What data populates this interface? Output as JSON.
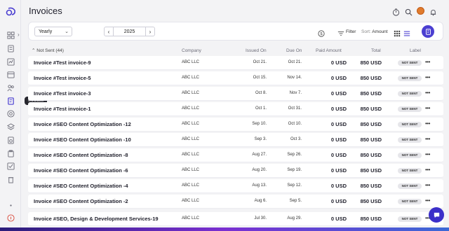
{
  "page": {
    "title": "Invoices",
    "tooltip": "Invoices"
  },
  "toolbar": {
    "period": "Yearly",
    "year": "2025",
    "filter_label": "Filter",
    "sort_label": "Sort:",
    "sort_value": "Amount"
  },
  "table": {
    "group_label": "Not Sent (44)",
    "columns": {
      "company": "Company",
      "issued": "Issued On",
      "due": "Due On",
      "paid": "Paid Amount",
      "total": "Total",
      "label": "Label"
    },
    "rows": [
      {
        "name": "Invoice #Test invoice-9",
        "company": "ABC LLC",
        "issued": "Oct 21.",
        "due": "Oct 21.",
        "paid": "0 USD",
        "total": "850 USD",
        "label": "NOT SENT"
      },
      {
        "name": "Invoice #Test invoice-5",
        "company": "ABC LLC",
        "issued": "Oct 15.",
        "due": "Nov 14.",
        "paid": "0 USD",
        "total": "850 USD",
        "label": "NOT SENT"
      },
      {
        "name": "Invoice #Test invoice-3",
        "company": "ABC LLC",
        "issued": "Oct 8.",
        "due": "Nov 7.",
        "paid": "0 USD",
        "total": "850 USD",
        "label": "NOT SENT"
      },
      {
        "name": "Invoice #Test invoice-1",
        "company": "ABC LLC",
        "issued": "Oct 1.",
        "due": "Oct 31.",
        "paid": "0 USD",
        "total": "850 USD",
        "label": "NOT SENT"
      },
      {
        "name": "Invoice #SEO Content Optimization -12",
        "company": "ABC LLC",
        "issued": "Sep 10.",
        "due": "Oct 10.",
        "paid": "0 USD",
        "total": "850 USD",
        "label": "NOT SENT"
      },
      {
        "name": "Invoice #SEO Content Optimization -10",
        "company": "ABC LLC",
        "issued": "Sep 3.",
        "due": "Oct 3.",
        "paid": "0 USD",
        "total": "850 USD",
        "label": "NOT SENT"
      },
      {
        "name": "Invoice #SEO Content Optimization -8",
        "company": "ABC LLC",
        "issued": "Aug 27.",
        "due": "Sep 26.",
        "paid": "0 USD",
        "total": "850 USD",
        "label": "NOT SENT"
      },
      {
        "name": "Invoice #SEO Content Optimization -6",
        "company": "ABC LLC",
        "issued": "Aug 20.",
        "due": "Sep 19.",
        "paid": "0 USD",
        "total": "850 USD",
        "label": "NOT SENT"
      },
      {
        "name": "Invoice #SEO Content Optimization -4",
        "company": "ABC LLC",
        "issued": "Aug 13.",
        "due": "Sep 12.",
        "paid": "0 USD",
        "total": "850 USD",
        "label": "NOT SENT"
      },
      {
        "name": "Invoice #SEO Content Optimization -2",
        "company": "ABC LLC",
        "issued": "Aug 6.",
        "due": "Sep 5.",
        "paid": "0 USD",
        "total": "850 USD",
        "label": "NOT SENT"
      },
      {
        "name": "Invoice #SEO, Design & Development Services-19",
        "company": "ABC LLC",
        "issued": "Jul 30.",
        "due": "Aug 29.",
        "paid": "0 USD",
        "total": "850 USD",
        "label": "NOT SENT"
      }
    ]
  },
  "colors": {
    "accent": "#4b3fd1",
    "badge_bg": "#e6e6ea"
  },
  "icons": {
    "sidebar": [
      "dashboard-icon",
      "document-icon",
      "chart-icon",
      "calendar-icon",
      "users-icon",
      "invoice-icon",
      "target-icon",
      "layers-icon",
      "timer-icon",
      "clipboard-icon",
      "checklist-icon",
      "trash-icon",
      "dot-icon",
      "help-icon"
    ],
    "top": [
      "timer-icon",
      "search-icon",
      "avatar",
      "bell-icon"
    ]
  }
}
